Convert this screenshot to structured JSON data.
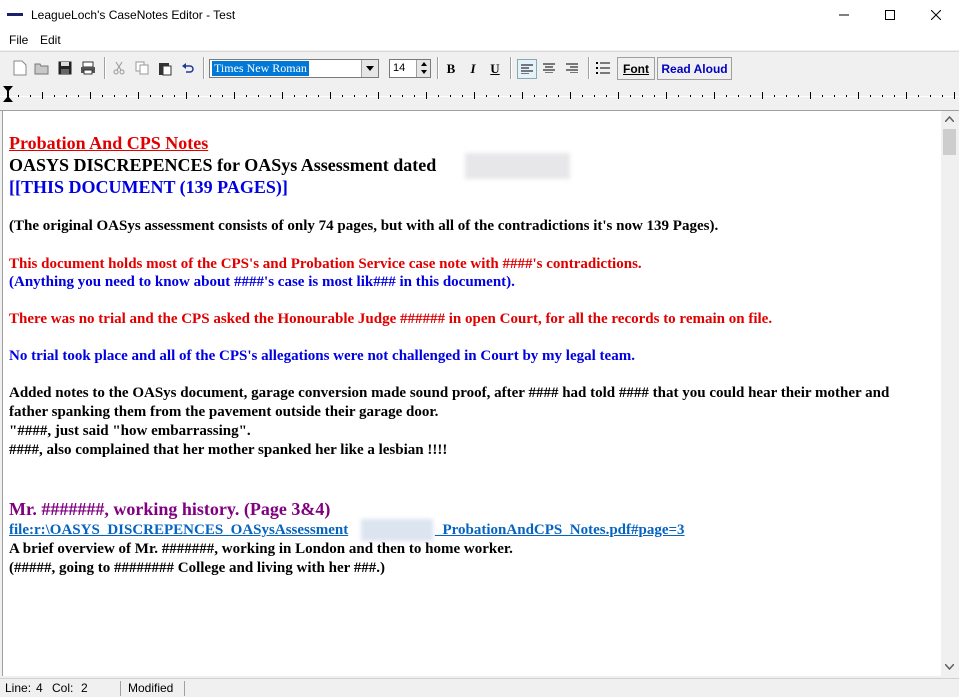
{
  "window": {
    "title": "LeagueLoch's CaseNotes Editor - Test"
  },
  "menu": {
    "file": "File",
    "edit": "Edit"
  },
  "toolbar": {
    "font_name": "Times New Roman",
    "font_size": "14",
    "bold": "B",
    "italic": "I",
    "underline": "U",
    "font_button": "Font",
    "read_aloud_button": "Read Aloud",
    "icons": [
      "new-icon",
      "open-icon",
      "save-icon",
      "print-icon",
      "cut-icon",
      "copy-icon",
      "paste-icon",
      "undo-icon",
      "align-left-icon",
      "align-center-icon",
      "align-right-icon",
      "bullets-icon"
    ]
  },
  "document": {
    "heading": "Probation And CPS Notes",
    "subheading": "OASYS DISCREPENCES for OASys Assessment dated",
    "doc_link": "[[THIS DOCUMENT (139 PAGES)]",
    "para1": "(The original OASys assessment consists of only 74 pages, but with all of the contradictions it's now 139 Pages).",
    "para2a": "This document holds most of the CPS's and Probation Service case note with ####'s contradictions.",
    "para2b": "(Anything you need to know about ####'s case is most lik### in this document).",
    "para3": "There was no trial and the CPS asked the Honourable Judge ###### in open Court, for all the records to remain on file.",
    "para4": "No trial took place and all of the CPS's allegations were not challenged in Court by my legal team.",
    "para5_1": "Added notes to the OASys document, garage conversion made sound proof, after #### had told #### that you could hear their mother and",
    "para5_2": "father spanking them from the pavement outside their garage door.",
    "para5_3": "\"####, just said \"how embarrassing\".",
    "para5_4": "####, also complained that her mother spanked her like a lesbian !!!!",
    "section_heading": "Mr. #######, working history. (Page 3&4)",
    "file_link_a": "file:r:\\OASYS_DISCREPENCES_OASysAssessment",
    "file_link_b": "_ProbationAndCPS_Notes.pdf#page=3",
    "para6": "A brief overview of Mr. #######, working in London and then to home worker.",
    "para7": "(#####, going to ######## College and living with her ###.)"
  },
  "status": {
    "line_label": "Line:",
    "line": "4",
    "col_label": "Col:",
    "col": "2",
    "state": "Modified"
  },
  "colors": {
    "red": "#e00000",
    "blue": "#0000e0",
    "purple": "#800080",
    "link": "#0563c1",
    "selection": "#0078d7"
  }
}
